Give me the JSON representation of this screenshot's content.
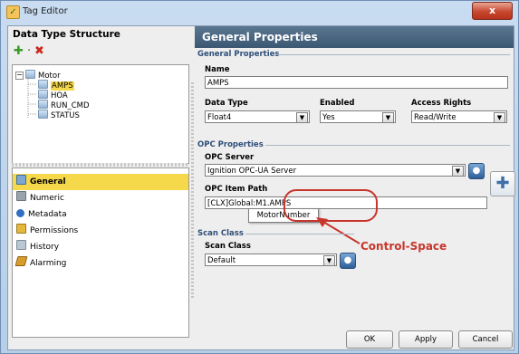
{
  "window": {
    "title": "Tag Editor",
    "close_label": "x"
  },
  "left_panel": {
    "header": "Data Type Structure",
    "toolbar": {
      "add_symbol": "✚",
      "separator": "·",
      "delete_symbol": "✖"
    },
    "tree": {
      "root": "Motor",
      "root_expander": "−",
      "children": [
        "AMPS",
        "HOA",
        "RUN_CMD",
        "STATUS"
      ],
      "selected": "AMPS"
    },
    "categories": [
      {
        "label": "General",
        "active": true
      },
      {
        "label": "Numeric",
        "active": false
      },
      {
        "label": "Metadata",
        "active": false
      },
      {
        "label": "Permissions",
        "active": false
      },
      {
        "label": "History",
        "active": false
      },
      {
        "label": "Alarming",
        "active": false
      }
    ]
  },
  "right_panel": {
    "header": "General Properties",
    "general_section": {
      "title": "General Properties",
      "name_label": "Name",
      "name_value": "AMPS",
      "data_type_label": "Data Type",
      "data_type_value": "Float4",
      "enabled_label": "Enabled",
      "enabled_value": "Yes",
      "access_label": "Access Rights",
      "access_value": "Read/Write"
    },
    "opc_section": {
      "title": "OPC Properties",
      "server_label": "OPC Server",
      "server_value": "Ignition OPC-UA Server",
      "path_label": "OPC Item Path",
      "path_value": "[CLX]Global:M1.AMPS",
      "autocomplete_suggestion": "MotorNumber"
    },
    "scan_section": {
      "title": "Scan Class",
      "scan_label": "Scan Class",
      "scan_value": "Default"
    },
    "annotation": "Control-Space",
    "buttons": {
      "ok": "OK",
      "apply": "Apply",
      "cancel": "Cancel"
    }
  },
  "colors": {
    "header_bg": "#3b5873",
    "selection": "#f5d94a",
    "annotation": "#c8352b"
  }
}
